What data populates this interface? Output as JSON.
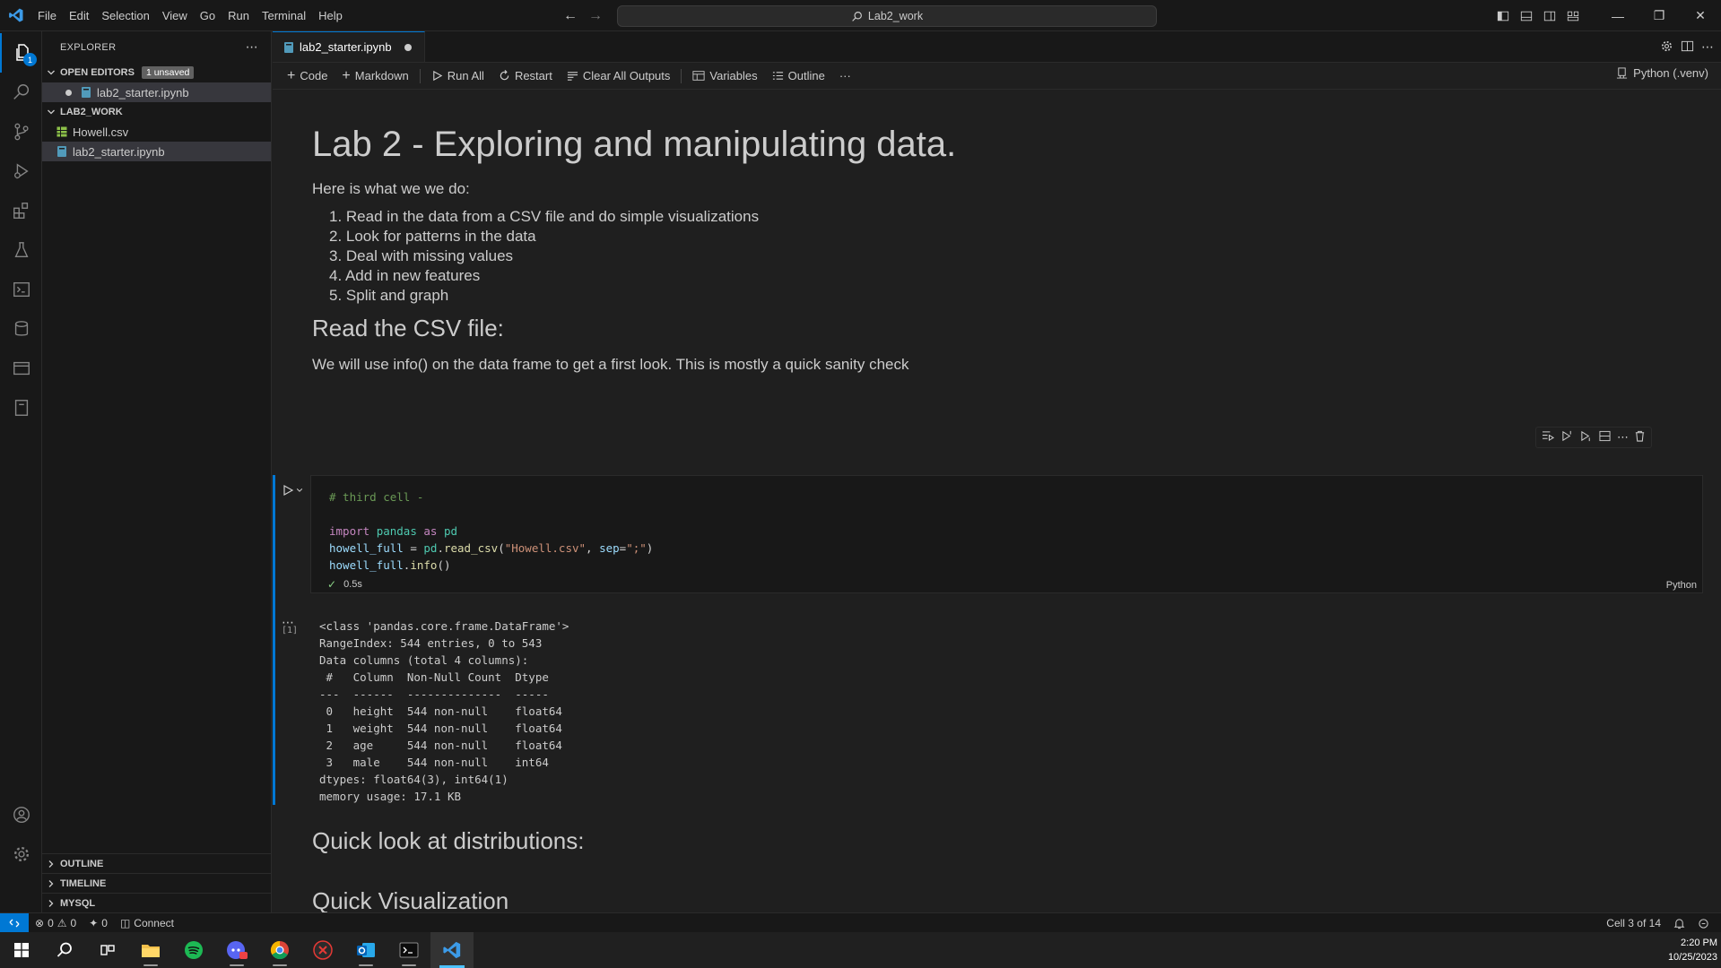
{
  "menu": [
    "File",
    "Edit",
    "Selection",
    "View",
    "Go",
    "Run",
    "Terminal",
    "Help"
  ],
  "search": {
    "label": "Lab2_work"
  },
  "sidebar": {
    "title": "EXPLORER",
    "open_editors_label": "OPEN EDITORS",
    "unsaved_badge": "1 unsaved",
    "open_editors": [
      {
        "name": "lab2_starter.ipynb"
      }
    ],
    "folder_label": "LAB2_WORK",
    "files": [
      {
        "name": "Howell.csv"
      },
      {
        "name": "lab2_starter.ipynb"
      }
    ],
    "bottom_sections": [
      "OUTLINE",
      "TIMELINE",
      "MYSQL"
    ],
    "explorer_badge": "1"
  },
  "tab": {
    "title": "lab2_starter.ipynb"
  },
  "toolbar": {
    "code": "Code",
    "markdown": "Markdown",
    "run_all": "Run All",
    "restart": "Restart",
    "clear_outputs": "Clear All Outputs",
    "variables": "Variables",
    "outline": "Outline",
    "more": "···",
    "kernel": "Python (.venv)"
  },
  "notebook": {
    "title": "Lab 2 - Exploring and manipulating data.",
    "intro": "Here is what we we do:",
    "steps": [
      "1. Read in the data from a CSV file and do simple visualizations",
      "2. Look for patterns in the data",
      "3. Deal with missing values",
      "4. Add in new features",
      "5. Split and graph"
    ],
    "h_read": "Read the CSV file:",
    "read_desc": "We will use info() on the data frame to get a first look. This is mostly a quick sanity check",
    "cell": {
      "exec_count": "[1]",
      "duration": "0.5s",
      "language": "Python",
      "comment": "# third cell -",
      "line_import": [
        "import",
        "pandas",
        "as",
        "pd"
      ],
      "line_read": [
        "howell_full",
        " = ",
        "pd",
        ".",
        "read_csv",
        "(",
        "\"Howell.csv\"",
        ", ",
        "sep",
        "=",
        "\";\"",
        ")"
      ],
      "line_info": [
        "howell_full",
        ".",
        "info",
        "()"
      ]
    },
    "output": [
      "<class 'pandas.core.frame.DataFrame'>",
      "RangeIndex: 544 entries, 0 to 543",
      "Data columns (total 4 columns):",
      " #   Column  Non-Null Count  Dtype  ",
      "---  ------  --------------  -----  ",
      " 0   height  544 non-null    float64",
      " 1   weight  544 non-null    float64",
      " 2   age     544 non-null    float64",
      " 3   male    544 non-null    int64  ",
      "dtypes: float64(3), int64(1)",
      "memory usage: 17.1 KB"
    ],
    "h_dist": "Quick look at distributions:",
    "h_vis": "Quick Visualization"
  },
  "status": {
    "errors": "0",
    "warnings": "0",
    "ports": "0",
    "connect": "Connect",
    "cell_pos": "Cell 3 of 14"
  },
  "clock": {
    "time": "2:20 PM",
    "date": "10/25/2023"
  },
  "colors": {
    "accent": "#0078d4",
    "background": "#1f1f1f",
    "sidebar": "#181818"
  }
}
